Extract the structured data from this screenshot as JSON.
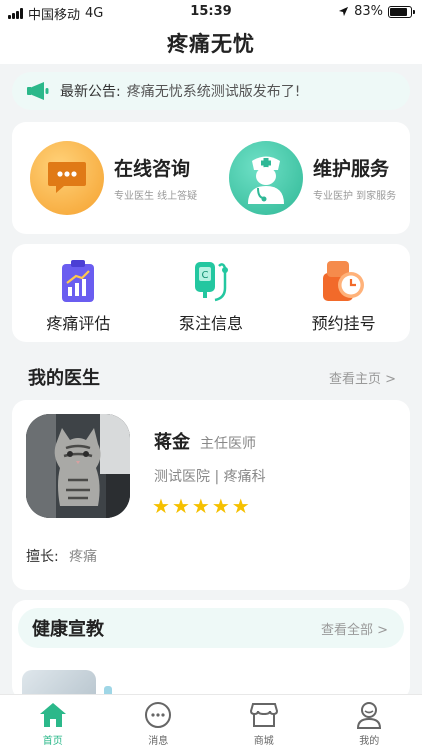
{
  "status_bar": {
    "carrier": "中国移动",
    "network": "4G",
    "time": "15:39",
    "battery": "83%",
    "battery_level": 0.83
  },
  "app_title": "疼痛无忧",
  "notice": {
    "label": "最新公告:",
    "text": "疼痛无忧系统测试版发布了!",
    "icon": "megaphone-icon"
  },
  "services": [
    {
      "name": "在线咨询",
      "sub": "专业医生  线上答疑",
      "icon": "chat-bubble-icon",
      "color": "#f5a12e"
    },
    {
      "name": "维护服务",
      "sub": "专业医护  到家服务",
      "icon": "nurse-icon",
      "color": "#35c9a6"
    }
  ],
  "quick_actions": [
    {
      "label": "疼痛评估",
      "icon": "clipboard-chart-icon"
    },
    {
      "label": "泵注信息",
      "icon": "infusion-pump-icon"
    },
    {
      "label": "预约挂号",
      "icon": "appointment-clock-icon"
    }
  ],
  "my_doctor": {
    "heading": "我的医生",
    "more": "查看主页 >",
    "name": "蒋金",
    "title": "主任医师",
    "hospital": "测试医院 | 疼痛科",
    "rating": 5,
    "skill_label": "擅长:",
    "skill_value": "疼痛"
  },
  "health_education": {
    "heading": "健康宣教",
    "more": "查看全部 >"
  },
  "tabs": [
    {
      "label": "首页",
      "icon": "home-icon",
      "active": true
    },
    {
      "label": "消息",
      "icon": "message-icon",
      "active": false
    },
    {
      "label": "商城",
      "icon": "store-icon",
      "active": false
    },
    {
      "label": "我的",
      "icon": "profile-icon",
      "active": false
    }
  ],
  "colors": {
    "accent": "#2bb88a",
    "notice_bg": "#eef9f7",
    "star": "#f5c000"
  }
}
